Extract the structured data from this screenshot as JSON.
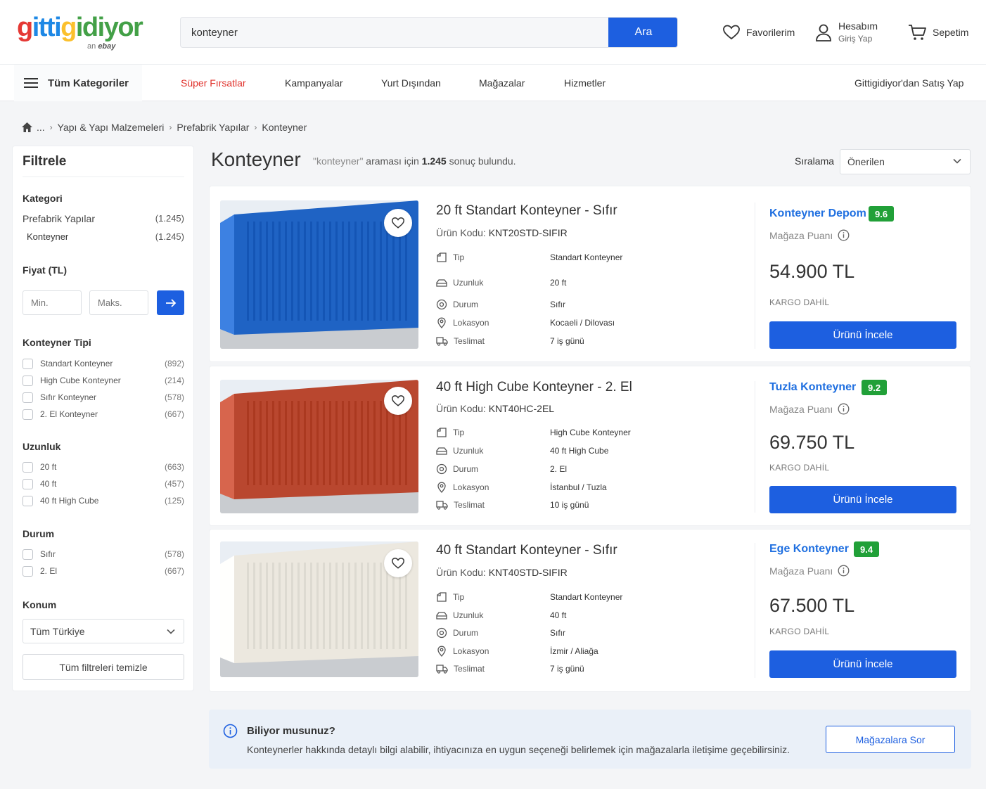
{
  "header": {
    "logo_text": "gittigidiyor",
    "logo_sub": "ebay",
    "logo_sub_prefix": "an",
    "search_value": "konteyner",
    "search_button": "Ara",
    "favorites": "Favorilerim",
    "account_title": "Hesabım",
    "account_sub": "Giriş Yap",
    "cart": "Sepetim"
  },
  "nav": {
    "all_categories": "Tüm Kategoriler",
    "items": [
      "Süper Fırsatlar",
      "Kampanyalar",
      "Yurt Dışından",
      "Mağazalar",
      "Hizmetler"
    ],
    "sell": "Gittigidiyor'dan Satış Yap"
  },
  "breadcrumb": [
    "...",
    "Yapı & Yapı Malzemeleri",
    "Prefabrik Yapılar",
    "Konteyner"
  ],
  "filter": {
    "title": "Filtrele",
    "category_title": "Kategori",
    "categories": [
      {
        "label": "Prefabrik Yapılar",
        "count": "(1.245)"
      },
      {
        "label": "Konteyner",
        "count": "(1.245)"
      }
    ],
    "price_title": "Fiyat (TL)",
    "price_min_placeholder": "Min.",
    "price_max_placeholder": "Maks.",
    "type_title": "Konteyner Tipi",
    "types": [
      {
        "label": "Standart Konteyner",
        "count": "(892)"
      },
      {
        "label": "High Cube Konteyner",
        "count": "(214)"
      },
      {
        "label": "Sıfır Konteyner",
        "count": "(578)"
      },
      {
        "label": "2. El Konteyner",
        "count": "(667)"
      }
    ],
    "length_title": "Uzunluk",
    "lengths": [
      {
        "label": "20 ft",
        "count": "(663)"
      },
      {
        "label": "40 ft",
        "count": "(457)"
      },
      {
        "label": "40 ft High Cube",
        "count": "(125)"
      }
    ],
    "condition_title": "Durum",
    "conditions": [
      {
        "label": "Sıfır",
        "count": "(578)"
      },
      {
        "label": "2. El",
        "count": "(667)"
      }
    ],
    "location_title": "Konum",
    "location_value": "Tüm Türkiye",
    "clear_button": "Tüm filtreleri temizle"
  },
  "results": {
    "heading": "Konteyner",
    "query": "\"konteyner\"",
    "note_mid": " araması için ",
    "count": "1.245",
    "note_end": " sonuç bulundu.",
    "sort_label": "Sıralama",
    "sort_value": "Önerilen"
  },
  "spec_labels": [
    "Tip",
    "Uzunluk",
    "Durum",
    "Lokasyon",
    "Teslimat"
  ],
  "products": [
    {
      "title": "20 ft Standart Konteyner - Sıfır",
      "code_label": "Ürün Kodu:",
      "code": "KNT20STD-SIFIR",
      "specs": [
        "Standart Konteyner",
        "20 ft",
        "Sıfır",
        "Kocaeli / Dilovası",
        "7 iş günü"
      ],
      "store": "Konteyner Depom",
      "score": "9.6",
      "store_label": "Mağaza Puanı",
      "price": "54.900 TL",
      "cargo": "KARGO DAHİL",
      "cta": "Ürünü İncele",
      "color": "#1f63c4"
    },
    {
      "title": "40 ft High Cube Konteyner - 2. El",
      "code_label": "Ürün Kodu:",
      "code": "KNT40HC-2EL",
      "specs": [
        "High Cube Konteyner",
        "40 ft High Cube",
        "2. El",
        "İstanbul / Tuzla",
        "10 iş günü"
      ],
      "store": "Tuzla Konteyner",
      "score": "9.2",
      "store_label": "Mağaza Puanı",
      "price": "69.750 TL",
      "cargo": "KARGO DAHİL",
      "cta": "Ürünü İncele",
      "color": "#b9472f"
    },
    {
      "title": "40 ft Standart Konteyner - Sıfır",
      "code_label": "Ürün Kodu:",
      "code": "KNT40STD-SIFIR",
      "specs": [
        "Standart Konteyner",
        "40 ft",
        "Sıfır",
        "İzmir / Aliağa",
        "7 iş günü"
      ],
      "store": "Ege Konteyner",
      "score": "9.4",
      "store_label": "Mağaza Puanı",
      "price": "67.500 TL",
      "cargo": "KARGO DAHİL",
      "cta": "Ürünü İncele",
      "color": "#ece8df"
    }
  ],
  "info": {
    "title": "Biliyor musunuz?",
    "text": "Konteynerler hakkında detaylı bilgi alabilir, ihtiyacınıza en uygun seçeneği belirlemek için mağazalarla iletişime geçebilirsiniz.",
    "button": "Mağazalara Sor"
  },
  "colors": {
    "accent": "#1d5fe0",
    "link": "#1f6fe0",
    "promo": "#e0312b",
    "score": "#21a038"
  }
}
